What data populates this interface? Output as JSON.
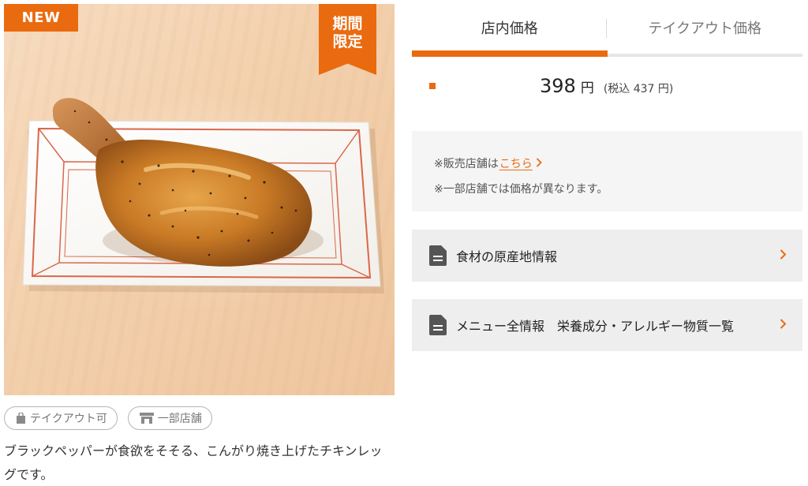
{
  "product": {
    "badge_new": "NEW",
    "badge_limited_line1": "期間",
    "badge_limited_line2": "限定",
    "photo_icon": "chicken-leg-photo",
    "tags": [
      {
        "label": "テイクアウト可",
        "icon": "takeout-bag-icon"
      },
      {
        "label": "一部店舗",
        "icon": "store-icon"
      }
    ],
    "description": "ブラックペッパーが食欲をそそる、こんがり焼き上げたチキンレッグです。"
  },
  "tabs": [
    {
      "label": "店内価格",
      "active": true
    },
    {
      "label": "テイクアウト価格",
      "active": false
    }
  ],
  "price": {
    "value": "398",
    "unit": "円",
    "tax_note": "(税込 437 円)"
  },
  "info": {
    "stores_prefix": "※販売店舗は",
    "stores_link": "こちら",
    "note": "※一部店舗では価格が異なります。"
  },
  "links": [
    {
      "label": "食材の原産地情報",
      "icon": "document-icon"
    },
    {
      "label": "メニュー全情報　栄養成分・アレルギー物質一覧",
      "icon": "document-icon"
    }
  ],
  "colors": {
    "accent": "#ea6a0f",
    "panel_bg": "#f5f5f5",
    "link_bg": "#eeeeee",
    "photo_bg": "#f3d0ad"
  }
}
